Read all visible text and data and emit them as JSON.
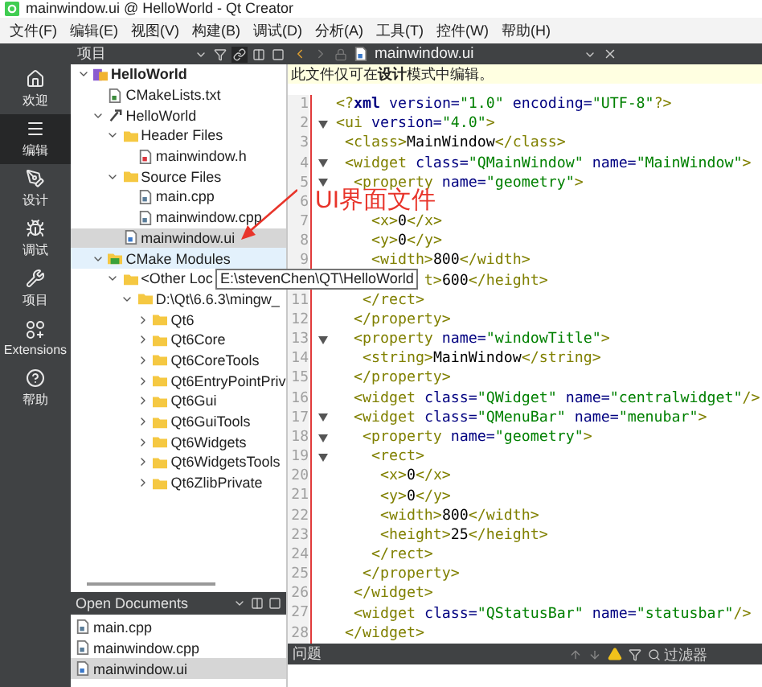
{
  "window": {
    "title": "mainwindow.ui @ HelloWorld - Qt Creator"
  },
  "menu": [
    "文件(F)",
    "编辑(E)",
    "视图(V)",
    "构建(B)",
    "调试(D)",
    "分析(A)",
    "工具(T)",
    "控件(W)",
    "帮助(H)"
  ],
  "modes": [
    {
      "label": "欢迎",
      "kind": "home",
      "selected": false
    },
    {
      "label": "编辑",
      "kind": "edit",
      "selected": true
    },
    {
      "label": "设计",
      "kind": "design",
      "selected": false
    },
    {
      "label": "调试",
      "kind": "debug",
      "selected": false
    },
    {
      "label": "项目",
      "kind": "projects",
      "selected": false
    },
    {
      "label": "Extensions",
      "kind": "extensions",
      "selected": false
    },
    {
      "label": "帮助",
      "kind": "help",
      "selected": false
    }
  ],
  "project_pane": {
    "title": "项目"
  },
  "tree": [
    {
      "label": "HelloWorld",
      "kind": "project",
      "expanded": true,
      "selected": false,
      "hovered": false,
      "children": [
        {
          "label": "CMakeLists.txt",
          "kind": "cmake-file",
          "selected": false,
          "hovered": false
        },
        {
          "label": "HelloWorld",
          "kind": "product",
          "expanded": true,
          "selected": false,
          "hovered": false,
          "children": [
            {
              "label": "Header Files",
              "kind": "folder",
              "expanded": true,
              "selected": false,
              "hovered": false,
              "children": [
                {
                  "label": "mainwindow.h",
                  "kind": "header",
                  "selected": false,
                  "hovered": false
                }
              ]
            },
            {
              "label": "Source Files",
              "kind": "folder",
              "expanded": true,
              "selected": false,
              "hovered": false,
              "children": [
                {
                  "label": "main.cpp",
                  "kind": "source",
                  "selected": false,
                  "hovered": false
                },
                {
                  "label": "mainwindow.cpp",
                  "kind": "source",
                  "selected": false,
                  "hovered": false
                }
              ]
            },
            {
              "label": "mainwindow.ui",
              "kind": "form",
              "selected": true,
              "hovered": false
            }
          ]
        },
        {
          "label": "CMake Modules",
          "kind": "cmake-folder",
          "expanded": true,
          "selected": false,
          "hovered": true,
          "children": [
            {
              "label": "<Other Loc",
              "kind": "folder",
              "expanded": true,
              "selected": false,
              "hovered": false,
              "children": [
                {
                  "label": "D:\\Qt\\6.6.3\\mingw_",
                  "kind": "folder",
                  "expanded": true,
                  "selected": false,
                  "hovered": false,
                  "children": [
                    {
                      "label": "Qt6",
                      "kind": "folder",
                      "expanded": false,
                      "selected": false,
                      "hovered": false
                    },
                    {
                      "label": "Qt6Core",
                      "kind": "folder",
                      "expanded": false,
                      "selected": false,
                      "hovered": false
                    },
                    {
                      "label": "Qt6CoreTools",
                      "kind": "folder",
                      "expanded": false,
                      "selected": false,
                      "hovered": false
                    },
                    {
                      "label": "Qt6EntryPointPriv",
                      "kind": "folder",
                      "expanded": false,
                      "selected": false,
                      "hovered": false
                    },
                    {
                      "label": "Qt6Gui",
                      "kind": "folder",
                      "expanded": false,
                      "selected": false,
                      "hovered": false
                    },
                    {
                      "label": "Qt6GuiTools",
                      "kind": "folder",
                      "expanded": false,
                      "selected": false,
                      "hovered": false
                    },
                    {
                      "label": "Qt6Widgets",
                      "kind": "folder",
                      "expanded": false,
                      "selected": false,
                      "hovered": false
                    },
                    {
                      "label": "Qt6WidgetsTools",
                      "kind": "folder",
                      "expanded": false,
                      "selected": false,
                      "hovered": false
                    },
                    {
                      "label": "Qt6ZlibPrivate",
                      "kind": "folder",
                      "expanded": false,
                      "selected": false,
                      "hovered": false
                    }
                  ]
                }
              ]
            }
          ]
        }
      ]
    }
  ],
  "tooltip": "E:\\stevenChen\\QT\\HelloWorld",
  "open_documents": {
    "title": "Open Documents",
    "items": [
      {
        "label": "main.cpp",
        "kind": "source",
        "selected": false
      },
      {
        "label": "mainwindow.cpp",
        "kind": "source",
        "selected": false
      },
      {
        "label": "mainwindow.ui",
        "kind": "form",
        "selected": true
      }
    ]
  },
  "editor": {
    "tab": "mainwindow.ui",
    "info": "此文件仅可在**设计**模式中编辑。",
    "lines": [
      {
        "number": "1",
        "fold": false,
        "code": [
          {
            "kind": "tag",
            "text": "<?"
          },
          {
            "kind": "decl",
            "text": "xml"
          },
          {
            "kind": "attr",
            "text": " version="
          },
          {
            "kind": "value",
            "text": "\"1.0\""
          },
          {
            "kind": "attr",
            "text": " encoding="
          },
          {
            "kind": "value",
            "text": "\"UTF-8\""
          },
          {
            "kind": "tag",
            "text": "?>"
          }
        ]
      },
      {
        "number": "2",
        "fold": true,
        "code": [
          {
            "kind": "tag",
            "text": "<ui"
          },
          {
            "kind": "attr",
            "text": " version="
          },
          {
            "kind": "value",
            "text": "\"4.0\""
          },
          {
            "kind": "tag",
            "text": ">"
          }
        ]
      },
      {
        "number": "3",
        "fold": false,
        "code": [
          {
            "kind": "tag",
            "text": " <class>"
          },
          {
            "kind": "text",
            "text": "MainWindow"
          },
          {
            "kind": "tag",
            "text": "</class>"
          }
        ]
      },
      {
        "number": "4",
        "fold": true,
        "code": [
          {
            "kind": "tag",
            "text": " <widget"
          },
          {
            "kind": "attr",
            "text": " class="
          },
          {
            "kind": "value",
            "text": "\"QMainWindow\""
          },
          {
            "kind": "attr",
            "text": " name="
          },
          {
            "kind": "value",
            "text": "\"MainWindow\""
          },
          {
            "kind": "tag",
            "text": ">"
          }
        ]
      },
      {
        "number": "5",
        "fold": true,
        "code": [
          {
            "kind": "tag",
            "text": "  <property"
          },
          {
            "kind": "attr",
            "text": " name="
          },
          {
            "kind": "value",
            "text": "\"geometry\""
          },
          {
            "kind": "tag",
            "text": ">"
          }
        ]
      },
      {
        "number": "6",
        "fold": false
      },
      {
        "number": "7",
        "fold": false,
        "code": [
          {
            "kind": "tag",
            "text": "    <x>"
          },
          {
            "kind": "text",
            "text": "0"
          },
          {
            "kind": "tag",
            "text": "</x>"
          }
        ]
      },
      {
        "number": "8",
        "fold": false,
        "code": [
          {
            "kind": "tag",
            "text": "    <y>"
          },
          {
            "kind": "text",
            "text": "0"
          },
          {
            "kind": "tag",
            "text": "</y>"
          }
        ]
      },
      {
        "number": "9",
        "fold": false,
        "code": [
          {
            "kind": "tag",
            "text": "    <width>"
          },
          {
            "kind": "text",
            "text": "800"
          },
          {
            "kind": "tag",
            "text": "</width>"
          }
        ]
      },
      {
        "code": [
          {
            "kind": "tag",
            "text": "          t>"
          },
          {
            "kind": "text",
            "text": "600"
          },
          {
            "kind": "tag",
            "text": "</height>"
          }
        ]
      },
      {
        "number": "11",
        "fold": false,
        "code": [
          {
            "kind": "tag",
            "text": "   </rect>"
          }
        ]
      },
      {
        "number": "12",
        "fold": false,
        "code": [
          {
            "kind": "tag",
            "text": "  </property>"
          }
        ]
      },
      {
        "number": "13",
        "fold": true,
        "code": [
          {
            "kind": "tag",
            "text": "  <property"
          },
          {
            "kind": "attr",
            "text": " name="
          },
          {
            "kind": "value",
            "text": "\"windowTitle\""
          },
          {
            "kind": "tag",
            "text": ">"
          }
        ]
      },
      {
        "number": "14",
        "fold": false,
        "code": [
          {
            "kind": "tag",
            "text": "   <string>"
          },
          {
            "kind": "text",
            "text": "MainWindow"
          },
          {
            "kind": "tag",
            "text": "</string>"
          }
        ]
      },
      {
        "number": "15",
        "fold": false,
        "code": [
          {
            "kind": "tag",
            "text": "  </property>"
          }
        ]
      },
      {
        "number": "16",
        "fold": false,
        "code": [
          {
            "kind": "tag",
            "text": "  <widget"
          },
          {
            "kind": "attr",
            "text": " class="
          },
          {
            "kind": "value",
            "text": "\"QWidget\""
          },
          {
            "kind": "attr",
            "text": " name="
          },
          {
            "kind": "value",
            "text": "\"centralwidget\""
          },
          {
            "kind": "tag",
            "text": "/>"
          }
        ]
      },
      {
        "number": "17",
        "fold": true,
        "code": [
          {
            "kind": "tag",
            "text": "  <widget"
          },
          {
            "kind": "attr",
            "text": " class="
          },
          {
            "kind": "value",
            "text": "\"QMenuBar\""
          },
          {
            "kind": "attr",
            "text": " name="
          },
          {
            "kind": "value",
            "text": "\"menubar\""
          },
          {
            "kind": "tag",
            "text": ">"
          }
        ]
      },
      {
        "number": "18",
        "fold": true,
        "code": [
          {
            "kind": "tag",
            "text": "   <property"
          },
          {
            "kind": "attr",
            "text": " name="
          },
          {
            "kind": "value",
            "text": "\"geometry\""
          },
          {
            "kind": "tag",
            "text": ">"
          }
        ]
      },
      {
        "number": "19",
        "fold": true,
        "code": [
          {
            "kind": "tag",
            "text": "    <rect>"
          }
        ]
      },
      {
        "number": "20",
        "fold": false,
        "code": [
          {
            "kind": "tag",
            "text": "     <x>"
          },
          {
            "kind": "text",
            "text": "0"
          },
          {
            "kind": "tag",
            "text": "</x>"
          }
        ]
      },
      {
        "number": "21",
        "fold": false,
        "code": [
          {
            "kind": "tag",
            "text": "     <y>"
          },
          {
            "kind": "text",
            "text": "0"
          },
          {
            "kind": "tag",
            "text": "</y>"
          }
        ]
      },
      {
        "number": "22",
        "fold": false,
        "code": [
          {
            "kind": "tag",
            "text": "     <width>"
          },
          {
            "kind": "text",
            "text": "800"
          },
          {
            "kind": "tag",
            "text": "</width>"
          }
        ]
      },
      {
        "number": "23",
        "fold": false,
        "code": [
          {
            "kind": "tag",
            "text": "     <height>"
          },
          {
            "kind": "text",
            "text": "25"
          },
          {
            "kind": "tag",
            "text": "</height>"
          }
        ]
      },
      {
        "number": "24",
        "fold": false,
        "code": [
          {
            "kind": "tag",
            "text": "    </rect>"
          }
        ]
      },
      {
        "number": "25",
        "fold": false,
        "code": [
          {
            "kind": "tag",
            "text": "   </property>"
          }
        ]
      },
      {
        "number": "26",
        "fold": false,
        "code": [
          {
            "kind": "tag",
            "text": "  </widget>"
          }
        ]
      },
      {
        "number": "27",
        "fold": false,
        "code": [
          {
            "kind": "tag",
            "text": "  <widget"
          },
          {
            "kind": "attr",
            "text": " class="
          },
          {
            "kind": "value",
            "text": "\"QStatusBar\""
          },
          {
            "kind": "attr",
            "text": " name="
          },
          {
            "kind": "value",
            "text": "\"statusbar\""
          },
          {
            "kind": "tag",
            "text": "/>"
          }
        ]
      },
      {
        "number": "28",
        "fold": false,
        "code": [
          {
            "kind": "tag",
            "text": " </widget>"
          }
        ]
      }
    ]
  },
  "issues_pane": {
    "title": "问题",
    "filter": {
      "placeholder": "过滤器"
    }
  },
  "annotation": {
    "text": "UI界面文件"
  }
}
